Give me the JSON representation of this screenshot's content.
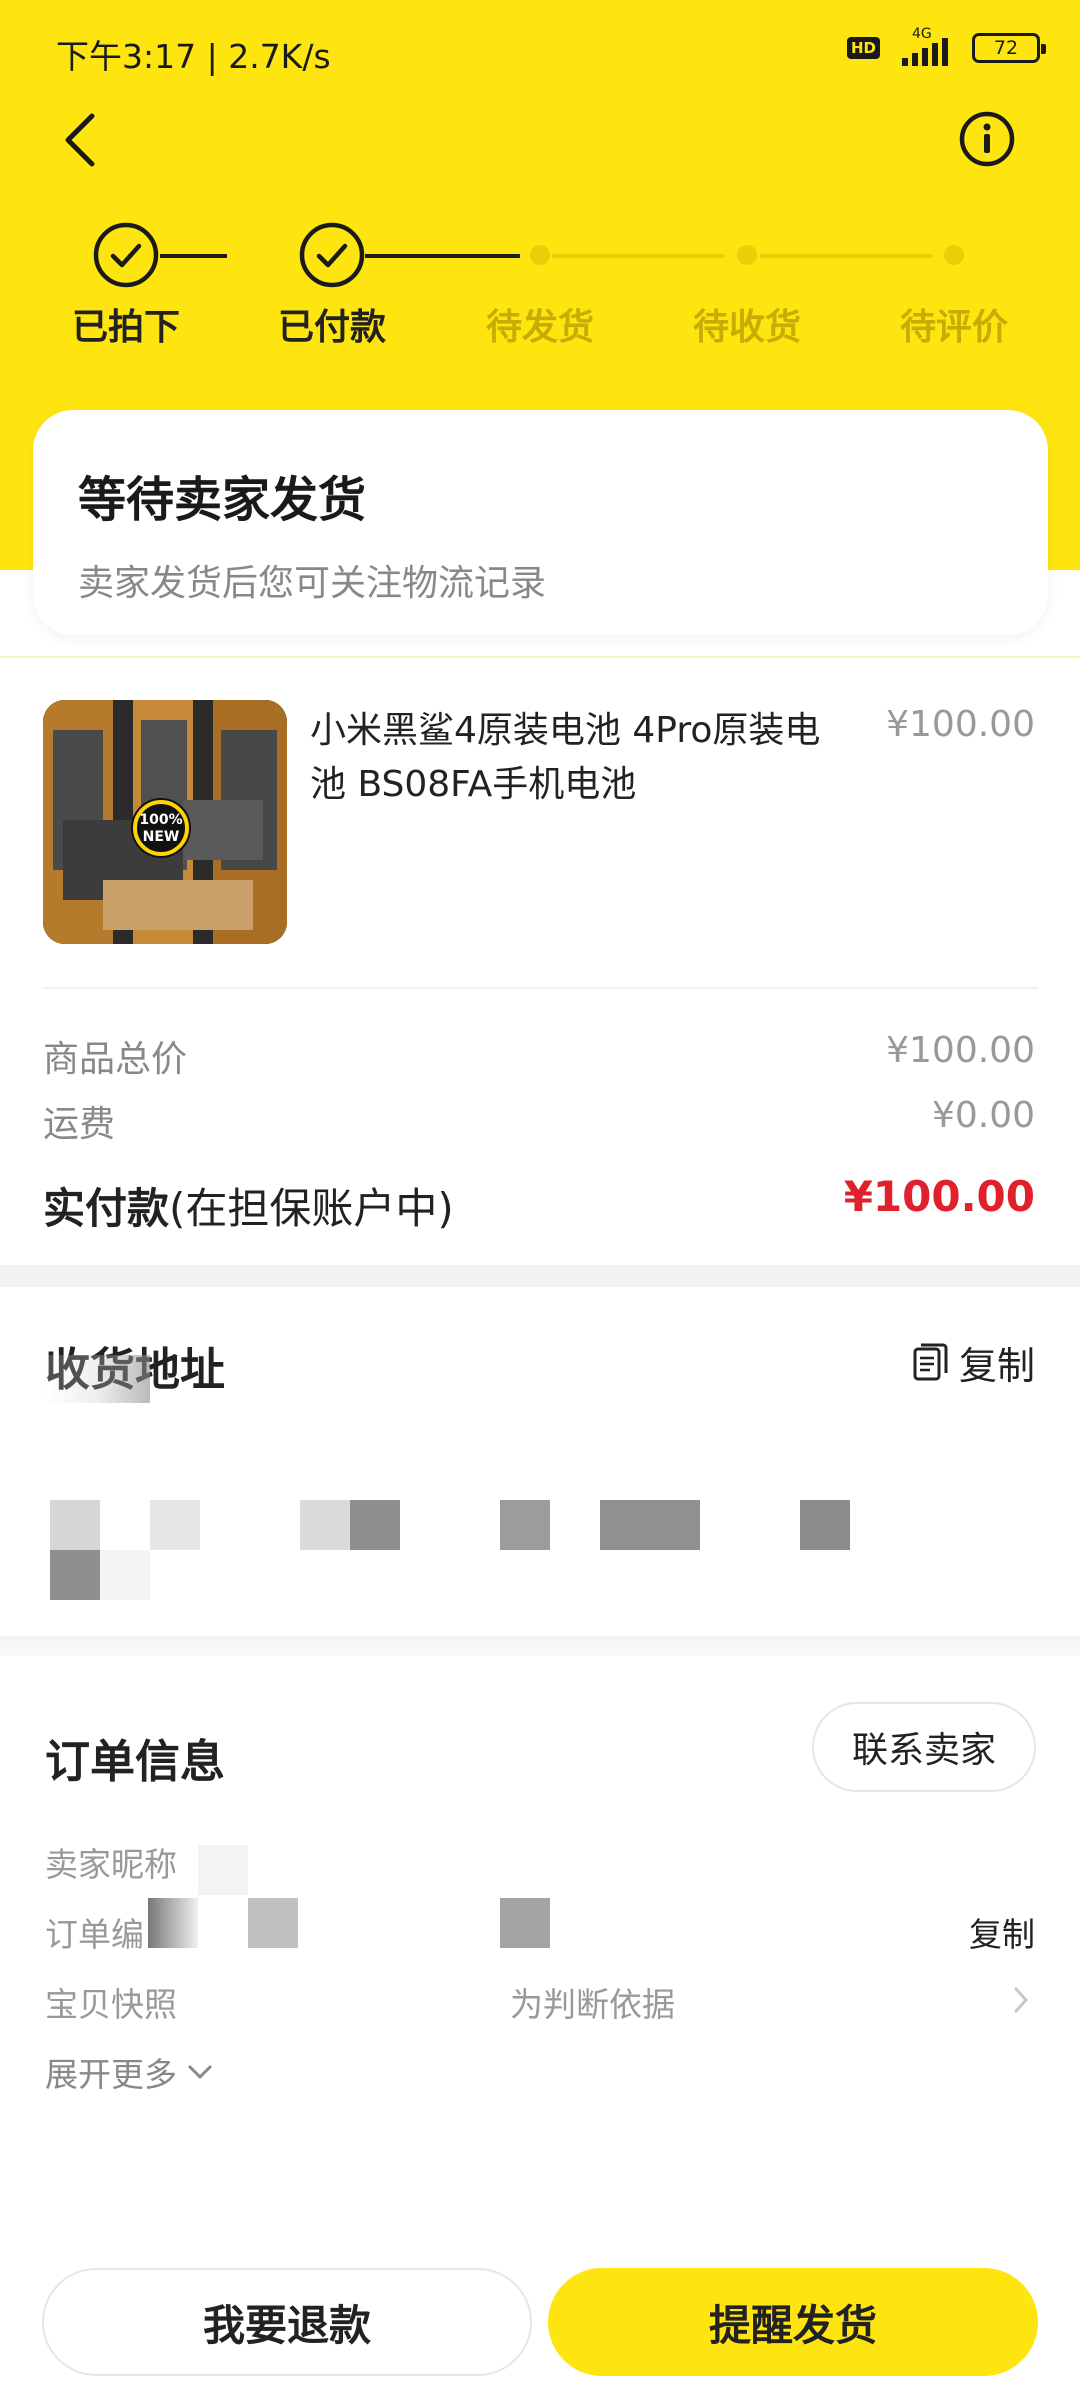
{
  "status_bar": {
    "time": "下午3:17 | 2.7K/s",
    "hd": "HD",
    "network": "4G",
    "battery": "72"
  },
  "icons": {
    "back": "chevron-left-icon",
    "info": "info-circle-icon",
    "copy": "copy-document-icon",
    "expand": "chevron-down-icon",
    "arrow": "chevron-right-icon",
    "check": "check-icon"
  },
  "colors": {
    "brand_yellow": "#ffe50f",
    "price_red": "#e0202a"
  },
  "steps": [
    {
      "label": "已拍下",
      "done": true
    },
    {
      "label": "已付款",
      "done": true
    },
    {
      "label": "待发货",
      "done": false
    },
    {
      "label": "待收货",
      "done": false
    },
    {
      "label": "待评价",
      "done": false
    }
  ],
  "status_card": {
    "title": "等待卖家发货",
    "subtitle": "卖家发货后您可关注物流记录"
  },
  "product": {
    "title": "小米黑鲨4原装电池 4Pro原装电池 BS08FA手机电池",
    "price": "¥100.00",
    "badge_line1": "100%",
    "badge_line2": "NEW"
  },
  "summary": {
    "goods_total_label": "商品总价",
    "goods_total_value": "¥100.00",
    "shipping_label": "运费",
    "shipping_value": "¥0.00",
    "paid_label_bold": "实付款",
    "paid_label_note": "(在担保账户中)",
    "paid_value": "¥100.00"
  },
  "address": {
    "title": "收货地址",
    "copy_label": "复制"
  },
  "order_info": {
    "title": "订单信息",
    "contact_seller": "联系卖家",
    "seller_nickname_label": "卖家昵称",
    "order_no_label": "订单编",
    "copy_label": "复制",
    "snapshot_label": "宝贝快照",
    "snapshot_note": "为判断依据",
    "expand_more": "展开更多"
  },
  "actions": {
    "refund": "我要退款",
    "remind": "提醒发货"
  }
}
